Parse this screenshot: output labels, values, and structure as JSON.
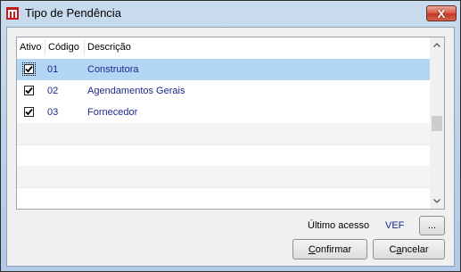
{
  "window": {
    "title": "Tipo de Pendência",
    "close_symbol": "X"
  },
  "grid": {
    "columns": [
      "Ativo",
      "Código",
      "Descrição"
    ],
    "rows": [
      {
        "ativo": true,
        "codigo": "01",
        "descricao": "Construtora",
        "selected": true
      },
      {
        "ativo": true,
        "codigo": "02",
        "descricao": "Agendamentos Gerais",
        "selected": false
      },
      {
        "ativo": true,
        "codigo": "03",
        "descricao": "Fornecedor",
        "selected": false
      }
    ]
  },
  "footer": {
    "ultimo_acesso_label": "Último acesso",
    "ultimo_acesso_user": "VEF",
    "dots_label": "...",
    "confirmar_first": "C",
    "confirmar_rest": "onfirmar",
    "cancelar_first": "C",
    "cancelar_second": "a",
    "cancelar_rest": "ncelar"
  },
  "colors": {
    "selection": "#b3d6f5",
    "value_text": "#1a2a8a",
    "close_button": "#c13a23"
  },
  "icons": {
    "app": "app-icon",
    "close": "close-icon",
    "scroll_up": "scroll-up-icon",
    "scroll_down": "scroll-down-icon",
    "check": "check-icon"
  }
}
